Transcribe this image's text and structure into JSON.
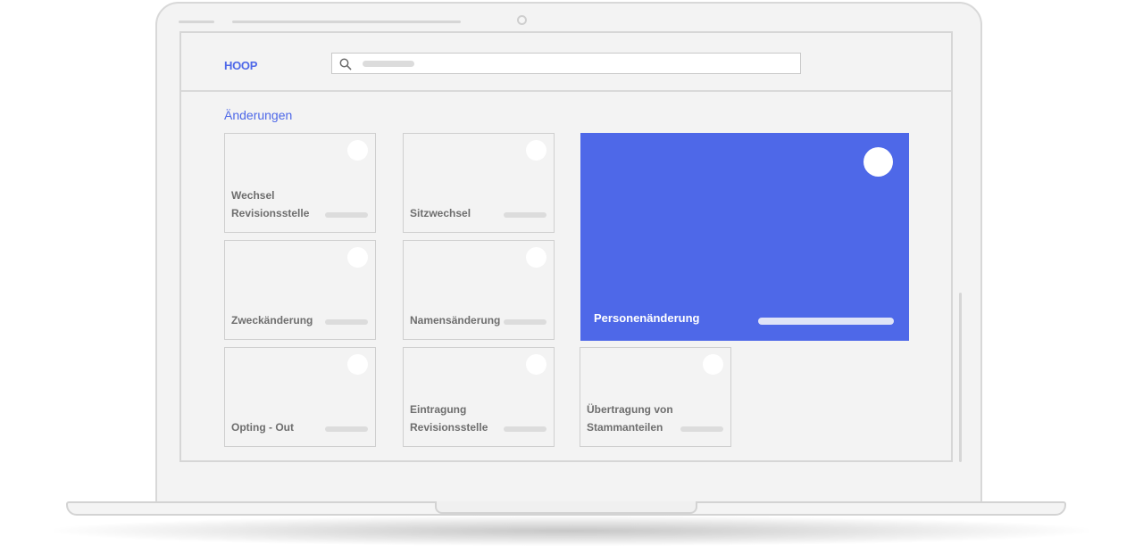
{
  "app": {
    "logo_text": "HOOP",
    "brand_color": "#4e68e8"
  },
  "search": {
    "icon": "search-icon",
    "placeholder": ""
  },
  "section": {
    "title": "Änderungen"
  },
  "tiles": [
    {
      "label": "Wechsel\nRevisionsstelle",
      "featured": false
    },
    {
      "label": "Sitzwechsel",
      "featured": false
    },
    {
      "label": "Personenänderung",
      "featured": true
    },
    {
      "label": "Zweckänderung",
      "featured": false
    },
    {
      "label": "Namensänderung",
      "featured": false
    },
    {
      "label": "Opting - Out",
      "featured": false
    },
    {
      "label": "Eintragung\nRevisionsstelle",
      "featured": false
    },
    {
      "label": "Übertragung von\nStammanteilen",
      "featured": false
    }
  ]
}
